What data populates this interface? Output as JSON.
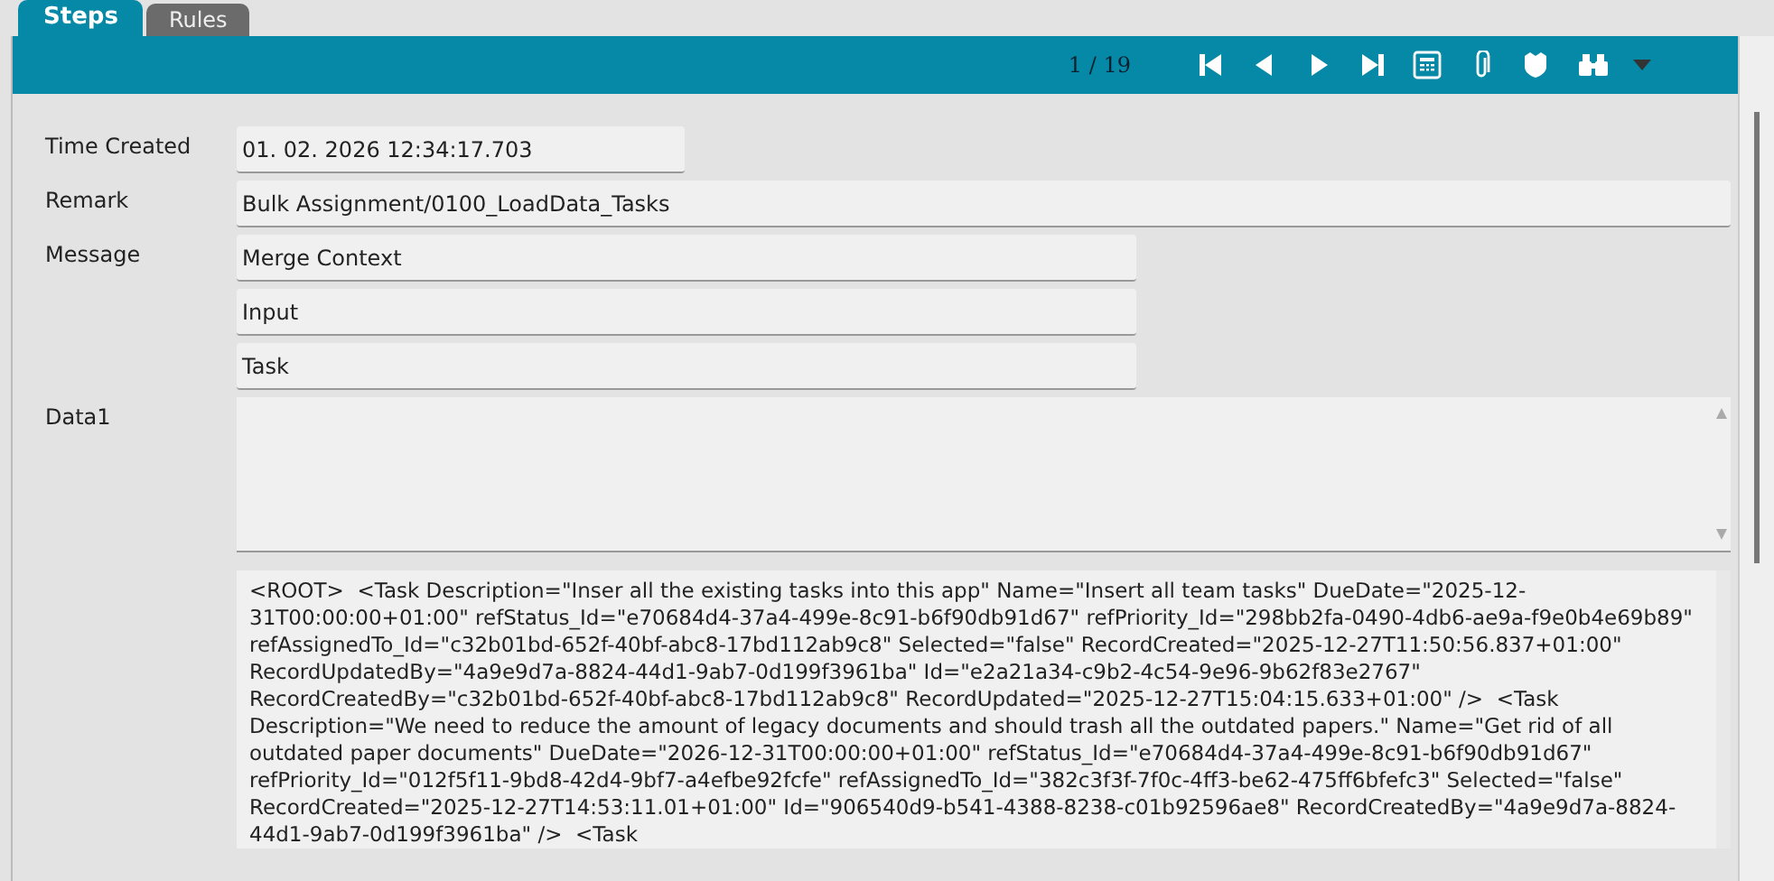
{
  "tabs": [
    {
      "label": "Steps",
      "selected": true
    },
    {
      "label": "Rules",
      "selected": false
    }
  ],
  "toolbar": {
    "counter": "1 / 19"
  },
  "fields": [
    {
      "label": "Time Created",
      "values": [
        "01. 02. 2026 12:34:17.703"
      ],
      "kind": "narrow"
    },
    {
      "label": "Remark",
      "values": [
        "Bulk Assignment/0100_LoadData_Tasks"
      ],
      "kind": "wide"
    },
    {
      "label": "Message",
      "values": [
        "Merge Context",
        "Input",
        "Task"
      ],
      "kind": "short"
    },
    {
      "label": "Data1",
      "kind": "textarea"
    }
  ],
  "xml_text": "<ROOT>  <Task Description=\"Inser all the existing tasks into this app\" Name=\"Insert all team tasks\" DueDate=\"2025-12-31T00:00:00+01:00\" refStatus_Id=\"e70684d4-37a4-499e-8c91-b6f90db91d67\" refPriority_Id=\"298bb2fa-0490-4db6-ae9a-f9e0b4e69b89\" refAssignedTo_Id=\"c32b01bd-652f-40bf-abc8-17bd112ab9c8\" Selected=\"false\" RecordCreated=\"2025-12-27T11:50:56.837+01:00\" RecordUpdatedBy=\"4a9e9d7a-8824-44d1-9ab7-0d199f3961ba\" Id=\"e2a21a34-c9b2-4c54-9e96-9b62f83e2767\" RecordCreatedBy=\"c32b01bd-652f-40bf-abc8-17bd112ab9c8\" RecordUpdated=\"2025-12-27T15:04:15.633+01:00\" />  <Task Description=\"We need to reduce the amount of legacy documents and should trash all the outdated papers.\" Name=\"Get rid of all outdated paper documents\" DueDate=\"2026-12-31T00:00:00+01:00\" refStatus_Id=\"e70684d4-37a4-499e-8c91-b6f90db91d67\" refPriority_Id=\"012f5f11-9bd8-42d4-9bf7-a4efbe92fcfe\" refAssignedTo_Id=\"382c3f3f-7f0c-4ff3-be62-475ff6bfefc3\" Selected=\"false\" RecordCreated=\"2025-12-27T14:53:11.01+01:00\" Id=\"906540d9-b541-4388-8238-c01b92596ae8\" RecordCreatedBy=\"4a9e9d7a-8824-44d1-9ab7-0d199f3961ba\" />  <Task"
}
